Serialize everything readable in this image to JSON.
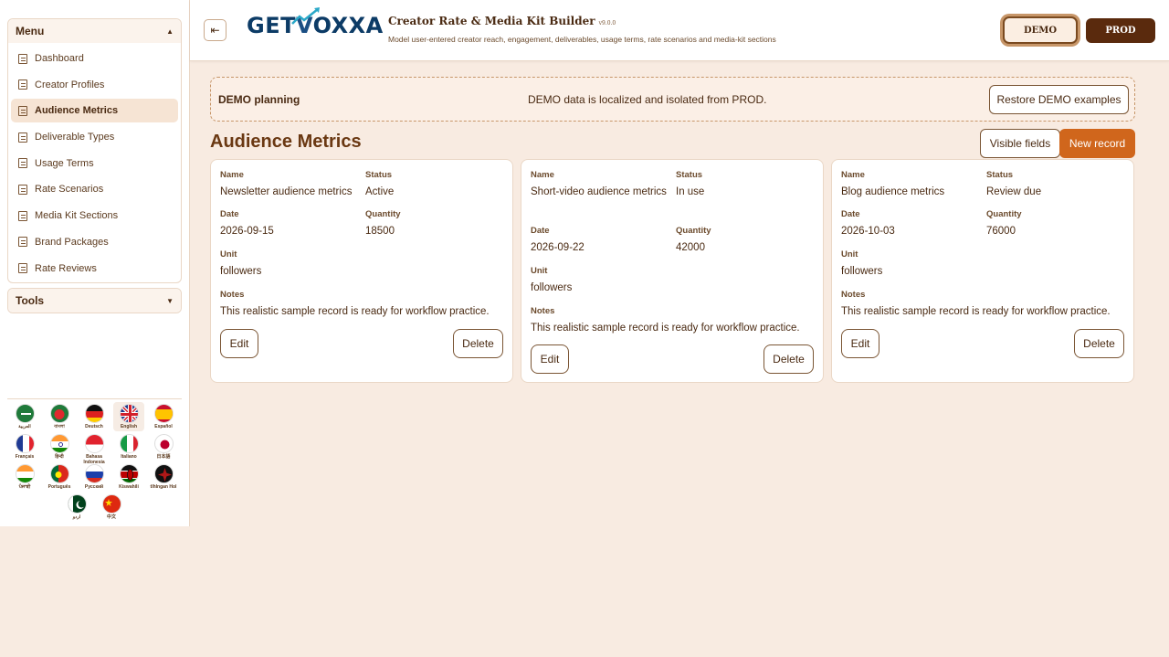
{
  "sidebar": {
    "menu_title": "Menu",
    "tools_title": "Tools",
    "items": [
      {
        "label": "Dashboard"
      },
      {
        "label": "Creator Profiles"
      },
      {
        "label": "Audience Metrics",
        "active": true
      },
      {
        "label": "Deliverable Types"
      },
      {
        "label": "Usage Terms"
      },
      {
        "label": "Rate Scenarios"
      },
      {
        "label": "Media Kit Sections"
      },
      {
        "label": "Brand Packages"
      },
      {
        "label": "Rate Reviews"
      }
    ],
    "languages": [
      {
        "label": "العربية",
        "icon": "flag-saudi-arabia-icon"
      },
      {
        "label": "বাংলা",
        "icon": "flag-bangladesh-icon"
      },
      {
        "label": "Deutsch",
        "icon": "flag-germany-icon"
      },
      {
        "label": "English",
        "icon": "flag-uk-icon",
        "selected": true
      },
      {
        "label": "Español",
        "icon": "flag-spain-icon"
      },
      {
        "label": "Français",
        "icon": "flag-france-icon"
      },
      {
        "label": "हिन्दी",
        "icon": "flag-india-icon"
      },
      {
        "label": "Bahasa Indonesia",
        "icon": "flag-indonesia-icon"
      },
      {
        "label": "Italiano",
        "icon": "flag-italy-icon"
      },
      {
        "label": "日本語",
        "icon": "flag-japan-icon"
      },
      {
        "label": "ਪੰਜਾਬੀ",
        "icon": "flag-india-punjabi-icon"
      },
      {
        "label": "Português",
        "icon": "flag-portugal-icon"
      },
      {
        "label": "Русский",
        "icon": "flag-russia-icon"
      },
      {
        "label": "Kiswahili",
        "icon": "flag-kenya-icon"
      },
      {
        "label": "tlhIngan Hol",
        "icon": "flag-klingon-icon"
      },
      {
        "label": "اردو",
        "icon": "flag-pakistan-icon"
      },
      {
        "label": "中文",
        "icon": "flag-china-icon"
      }
    ]
  },
  "header": {
    "logo_text_a": "GET",
    "logo_text_v": "V",
    "logo_text_b": "OXXA",
    "title": "Creator Rate & Media Kit Builder",
    "version": "v9.0.0",
    "subtitle": "Model user-entered creator reach, engagement, deliverables, usage terms, rate scenarios and media-kit sections",
    "demo_label": "DEMO",
    "prod_label": "PROD",
    "collapse_icon": "sidebar-collapse-icon"
  },
  "banner": {
    "title": "DEMO planning",
    "message": "DEMO data is localized and isolated from PROD.",
    "restore_label": "Restore DEMO examples"
  },
  "main": {
    "title": "Audience Metrics",
    "visible_fields_label": "Visible fields",
    "new_record_label": "New record"
  },
  "labels": {
    "name": "Name",
    "status": "Status",
    "date": "Date",
    "quantity": "Quantity",
    "unit": "Unit",
    "notes": "Notes",
    "edit": "Edit",
    "delete": "Delete"
  },
  "records": [
    {
      "name": "Newsletter audience metrics",
      "status": "Active",
      "date": "2026-09-15",
      "quantity": "18500",
      "unit": "followers",
      "notes": "This realistic sample record is ready for workflow practice."
    },
    {
      "name": "Short-video audience metrics",
      "status": "In use",
      "date": "2026-09-22",
      "quantity": "42000",
      "unit": "followers",
      "notes": "This realistic sample record is ready for workflow practice."
    },
    {
      "name": "Blog audience metrics",
      "status": "Review due",
      "date": "2026-10-03",
      "quantity": "76000",
      "unit": "followers",
      "notes": "This realistic sample record is ready for workflow practice."
    }
  ],
  "colors": {
    "accent": "#d0661c",
    "brand_dark": "#5a2a0d",
    "background": "#f8ebe1"
  }
}
